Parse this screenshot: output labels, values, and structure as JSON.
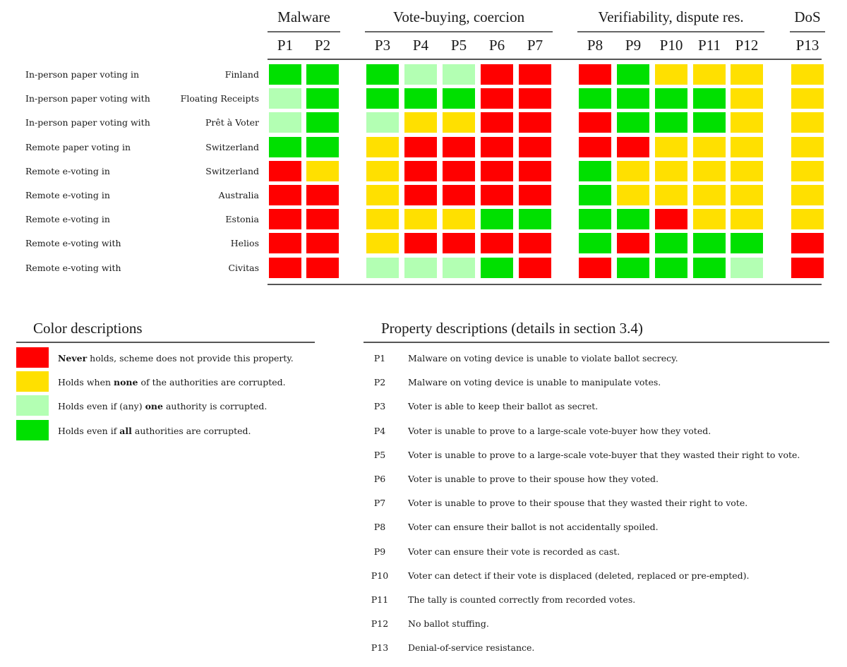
{
  "colors": {
    "never": "#ff0000",
    "none": "#ffe000",
    "one": "#b3ffb3",
    "all": "#00e000"
  },
  "chart_data": {
    "type": "heatmap",
    "groups": [
      {
        "name": "Malware",
        "columns": [
          "P1",
          "P2"
        ]
      },
      {
        "name": "Vote-buying, coercion",
        "columns": [
          "P3",
          "P4",
          "P5",
          "P6",
          "P7"
        ]
      },
      {
        "name": "Verifiability, dispute res.",
        "columns": [
          "P8",
          "P9",
          "P10",
          "P11",
          "P12"
        ]
      },
      {
        "name": "DoS",
        "columns": [
          "P13"
        ]
      }
    ],
    "columns": [
      "P1",
      "P2",
      "P3",
      "P4",
      "P5",
      "P6",
      "P7",
      "P8",
      "P9",
      "P10",
      "P11",
      "P12",
      "P13"
    ],
    "rows": [
      {
        "label": "In-person paper voting in",
        "system": "Finland",
        "values": [
          "all",
          "all",
          "all",
          "one",
          "one",
          "never",
          "never",
          "never",
          "all",
          "none",
          "none",
          "none",
          "none"
        ]
      },
      {
        "label": "In-person paper voting with",
        "system": "Floating Receipts",
        "values": [
          "one",
          "all",
          "all",
          "all",
          "all",
          "never",
          "never",
          "all",
          "all",
          "all",
          "all",
          "none",
          "none"
        ]
      },
      {
        "label": "In-person paper voting with",
        "system": "Prêt à Voter",
        "values": [
          "one",
          "all",
          "one",
          "none",
          "none",
          "never",
          "never",
          "never",
          "all",
          "all",
          "all",
          "none",
          "none"
        ]
      },
      {
        "label": "Remote paper voting in",
        "system": "Switzerland",
        "values": [
          "all",
          "all",
          "none",
          "never",
          "never",
          "never",
          "never",
          "never",
          "never",
          "none",
          "none",
          "none",
          "none"
        ]
      },
      {
        "label": "Remote e-voting in",
        "system": "Switzerland",
        "values": [
          "never",
          "none",
          "none",
          "never",
          "never",
          "never",
          "never",
          "all",
          "none",
          "none",
          "none",
          "none",
          "none"
        ]
      },
      {
        "label": "Remote e-voting in",
        "system": "Australia",
        "values": [
          "never",
          "never",
          "none",
          "never",
          "never",
          "never",
          "never",
          "all",
          "none",
          "none",
          "none",
          "none",
          "none"
        ]
      },
      {
        "label": "Remote e-voting in",
        "system": "Estonia",
        "values": [
          "never",
          "never",
          "none",
          "none",
          "none",
          "all",
          "all",
          "all",
          "all",
          "never",
          "none",
          "none",
          "none"
        ]
      },
      {
        "label": "Remote e-voting with",
        "system": "Helios",
        "values": [
          "never",
          "never",
          "none",
          "never",
          "never",
          "never",
          "never",
          "all",
          "never",
          "all",
          "all",
          "all",
          "never"
        ]
      },
      {
        "label": "Remote e-voting with",
        "system": "Civitas",
        "values": [
          "never",
          "never",
          "one",
          "one",
          "one",
          "all",
          "never",
          "never",
          "all",
          "all",
          "all",
          "one",
          "never"
        ]
      }
    ]
  },
  "legend": {
    "title": "Color descriptions",
    "items": [
      {
        "key": "never",
        "bold": "Never",
        "before": "",
        "after": " holds, scheme does not provide this property."
      },
      {
        "key": "none",
        "before": "Holds when ",
        "bold": "none",
        "after": " of the authorities are corrupted."
      },
      {
        "key": "one",
        "before": "Holds even if (any) ",
        "bold": "one",
        "after": " authority is corrupted."
      },
      {
        "key": "all",
        "before": "Holds even if ",
        "bold": "all",
        "after": " authorities are corrupted."
      }
    ]
  },
  "properties": {
    "title": "Property descriptions (details in section 3.4)",
    "items": [
      {
        "id": "P1",
        "text": "Malware on voting device is unable to violate ballot secrecy."
      },
      {
        "id": "P2",
        "text": "Malware on voting device is unable to manipulate votes."
      },
      {
        "id": "P3",
        "text": "Voter is able to keep their ballot as secret."
      },
      {
        "id": "P4",
        "text": "Voter is unable to prove to a large-scale vote-buyer how they voted."
      },
      {
        "id": "P5",
        "text": "Voter is unable to prove to a large-scale vote-buyer that they wasted their right to vote."
      },
      {
        "id": "P6",
        "text": "Voter is unable to prove to their spouse how they voted."
      },
      {
        "id": "P7",
        "text": "Voter is unable to prove to their spouse that they wasted their right to vote."
      },
      {
        "id": "P8",
        "text": "Voter can ensure their ballot is not accidentally spoiled."
      },
      {
        "id": "P9",
        "text": "Voter can ensure their vote is recorded as cast."
      },
      {
        "id": "P10",
        "text": "Voter can detect if their vote is displaced (deleted, replaced or pre-empted)."
      },
      {
        "id": "P11",
        "text": "The tally is counted correctly from recorded votes."
      },
      {
        "id": "P12",
        "text": "No ballot stuffing."
      },
      {
        "id": "P13",
        "text": "Denial-of-service resistance."
      }
    ]
  }
}
